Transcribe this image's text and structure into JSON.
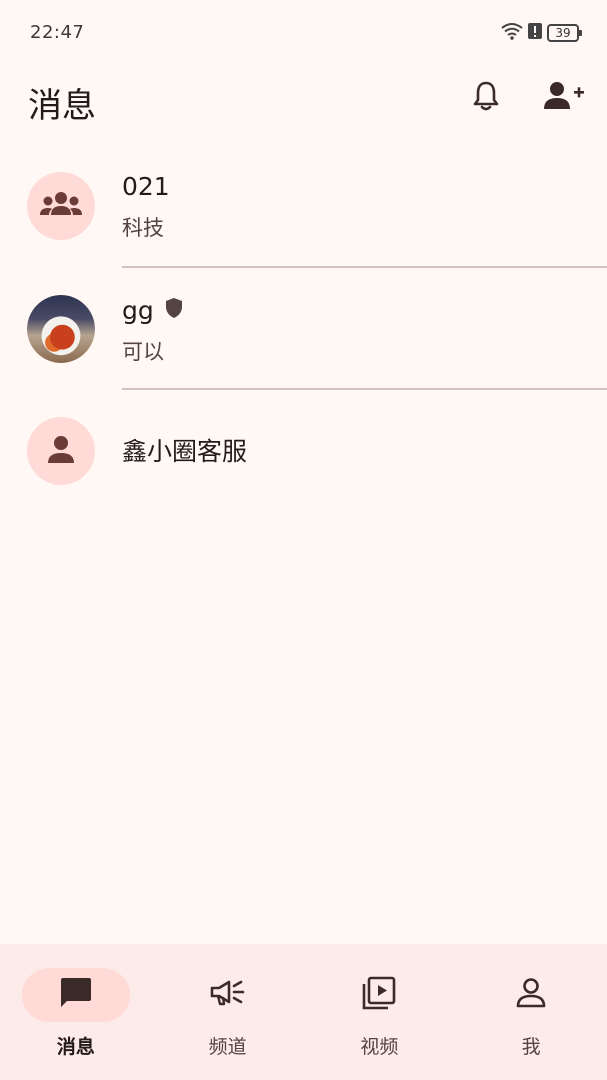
{
  "status_bar": {
    "time": "22:47",
    "battery": "39",
    "icons": [
      "wifi-icon",
      "alert-icon",
      "battery-icon"
    ]
  },
  "header": {
    "title": "消息",
    "actions": [
      {
        "name": "notifications",
        "icon": "bell-icon"
      },
      {
        "name": "add-contact",
        "icon": "person-add-icon"
      }
    ]
  },
  "conversations": [
    {
      "name": "021",
      "preview": "科技",
      "avatar_icon": "group-icon",
      "badge": null
    },
    {
      "name": "gg",
      "preview": "可以",
      "avatar_icon": "photo-avatar",
      "badge": "shield-icon"
    },
    {
      "name": "鑫小圈客服",
      "preview": "",
      "avatar_icon": "person-icon",
      "badge": null
    }
  ],
  "bottom_nav": {
    "items": [
      {
        "label": "消息",
        "icon": "chat-icon",
        "active": true
      },
      {
        "label": "频道",
        "icon": "campaign-icon",
        "active": false
      },
      {
        "label": "视频",
        "icon": "video-library-icon",
        "active": false
      },
      {
        "label": "我",
        "icon": "person-outline-icon",
        "active": false
      }
    ]
  },
  "colors": {
    "background": "#fff8f5",
    "accent_container": "#ffdad6",
    "icon": "#5a3b38",
    "nav_background": "#fcebe8",
    "divider": "#d8c2bf"
  }
}
